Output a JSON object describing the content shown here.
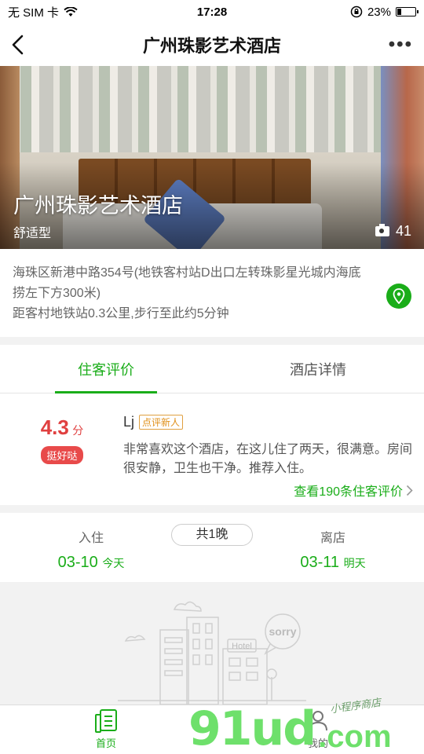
{
  "status_bar": {
    "carrier": "无 SIM 卡",
    "time": "17:28",
    "battery": "23%",
    "battery_level": 0.23
  },
  "nav": {
    "title": "广州珠影艺术酒店"
  },
  "hero": {
    "hotel_name": "广州珠影艺术酒店",
    "type": "舒适型",
    "photo_count": "41"
  },
  "address": {
    "line": "海珠区新港中路354号(地铁客村站D出口左转珠影星光城内海底捞左下方300米)",
    "distance": "距客村地铁站0.3公里,步行至此约5分钟"
  },
  "tabs": [
    {
      "label": "住客评价",
      "active": true
    },
    {
      "label": "酒店详情",
      "active": false
    }
  ],
  "review": {
    "score": "4.3",
    "score_unit": "分",
    "badge": "挺好哒",
    "reviewer": "Lj",
    "reviewer_tag": "点评新人",
    "text": "非常喜欢这个酒店，在这儿住了两天，很满意。房间很安静，卫生也干净。推荐入住。",
    "more_link": "查看190条住客评价"
  },
  "stay": {
    "checkin_label": "入住",
    "checkin_date": "03-10",
    "checkin_day": "今天",
    "nights": "共1晚",
    "checkout_label": "离店",
    "checkout_date": "03-11",
    "checkout_day": "明天"
  },
  "empty_state": {
    "hotel_sign": "Hotel",
    "sorry": "sorry"
  },
  "tabbar": {
    "home": "首页",
    "me": "我的"
  },
  "watermark": {
    "brand": "91ud",
    "com": ".com",
    "tagline": "小程序商店"
  },
  "colors": {
    "accent": "#1aad19",
    "score": "#e04040"
  }
}
